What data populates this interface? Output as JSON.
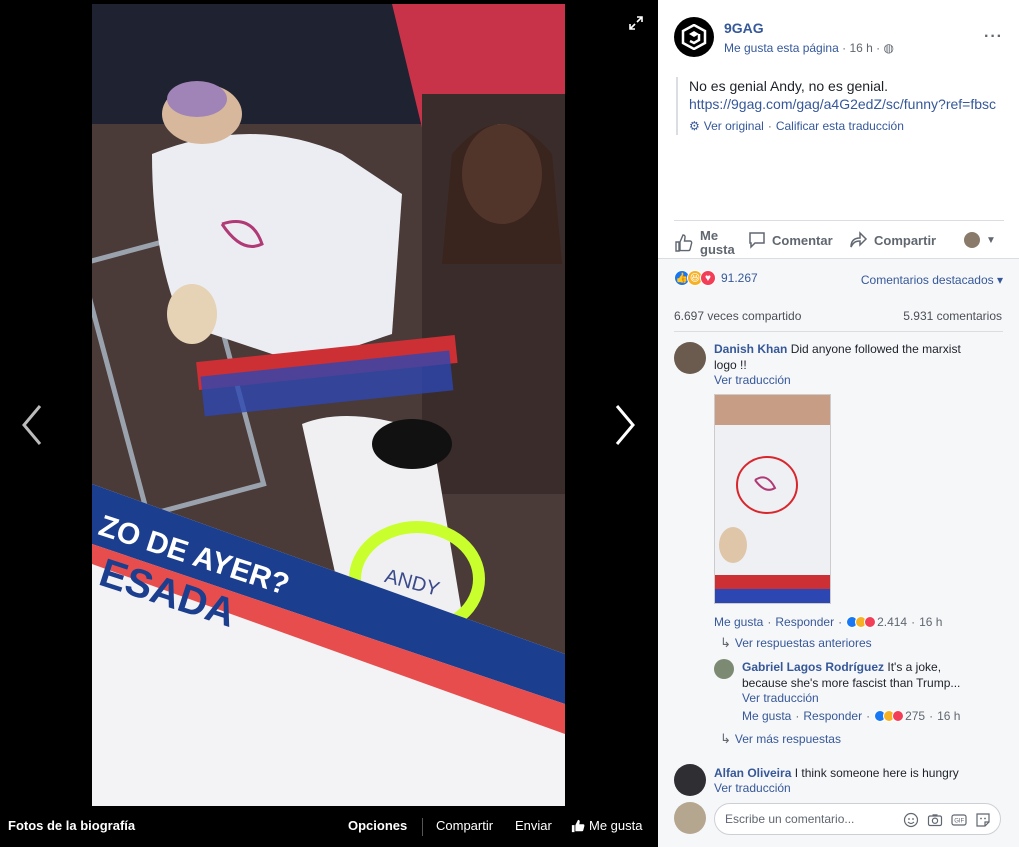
{
  "viewer": {
    "footer_title": "Fotos de la biografía",
    "options": "Opciones",
    "share": "Compartir",
    "send": "Enviar",
    "like": "Me gusta",
    "photo_caption_text": [
      "ZO DE AYER?",
      "ESADA"
    ],
    "cast_text": "ANDY"
  },
  "post": {
    "page_name": "9GAG",
    "page_like": "Me gusta esta página",
    "time": "16 h",
    "text": "No es genial Andy, no es genial.",
    "link": "https://9gag.com/gag/a4G2edZ/sc/funny?ref=fbsc",
    "see_original": "Ver original",
    "rate_translation": "Calificar esta traducción"
  },
  "actions": {
    "like_line1": "Me",
    "like_line2": "gusta",
    "comment": "Comentar",
    "share": "Compartir"
  },
  "stats": {
    "reactions": "91.267",
    "sort": "Comentarios destacados",
    "shares": "6.697 veces compartido",
    "comments": "5.931 comentarios"
  },
  "comments": [
    {
      "author": "Danish Khan",
      "text": "Did anyone followed the marxist logo !!",
      "translate": "Ver traducción",
      "like": "Me gusta",
      "reply": "Responder",
      "reactions": "2.414",
      "time": "16 h",
      "prev_replies": "Ver respuestas anteriores"
    },
    {
      "author": "Gabriel Lagos Rodríguez",
      "text": "It's a joke, because she's more fascist than Trump...",
      "translate": "Ver traducción",
      "like": "Me gusta",
      "reply": "Responder",
      "reactions": "275",
      "time": "16 h",
      "more_replies": "Ver más respuestas"
    },
    {
      "author": "Alfan Oliveira",
      "text": "I think someone here is hungry",
      "translate": "Ver traducción"
    }
  ],
  "comment_box": {
    "placeholder": "Escribe un comentario..."
  },
  "colors": {
    "link": "#365899",
    "like_blue": "#1877f2",
    "love_red": "#f33e58",
    "haha_yellow": "#f7b125"
  }
}
